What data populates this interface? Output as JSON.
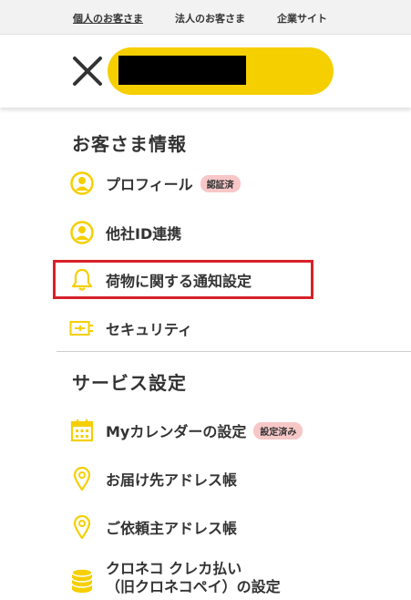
{
  "topnav": {
    "personal": "個人のお客さま",
    "business": "法人のお客さま",
    "corporate": "企業サイト"
  },
  "colors": {
    "accent": "#f6cf00",
    "badge": "#f7c7c7",
    "highlight": "#d7212a"
  },
  "customer_info": {
    "title": "お客さま情報",
    "items": [
      {
        "label": "プロフィール",
        "badge": "認証済",
        "icon": "person-circle-icon"
      },
      {
        "label": "他社ID連携",
        "icon": "person-circle-icon"
      },
      {
        "label": "荷物に関する通知設定",
        "icon": "bell-icon"
      },
      {
        "label": "セキュリティ",
        "icon": "security-key-icon"
      }
    ]
  },
  "service_settings": {
    "title": "サービス設定",
    "items": [
      {
        "label": "Myカレンダーの設定",
        "badge": "設定済み",
        "icon": "calendar-icon"
      },
      {
        "label": "お届け先アドレス帳",
        "icon": "map-pin-icon"
      },
      {
        "label": "ご依頼主アドレス帳",
        "icon": "map-pin-icon"
      },
      {
        "label_line1": "クロネコ クレカ払い",
        "label_line2": "（旧クロネコペイ）の設定",
        "icon": "coin-stack-icon"
      }
    ]
  }
}
